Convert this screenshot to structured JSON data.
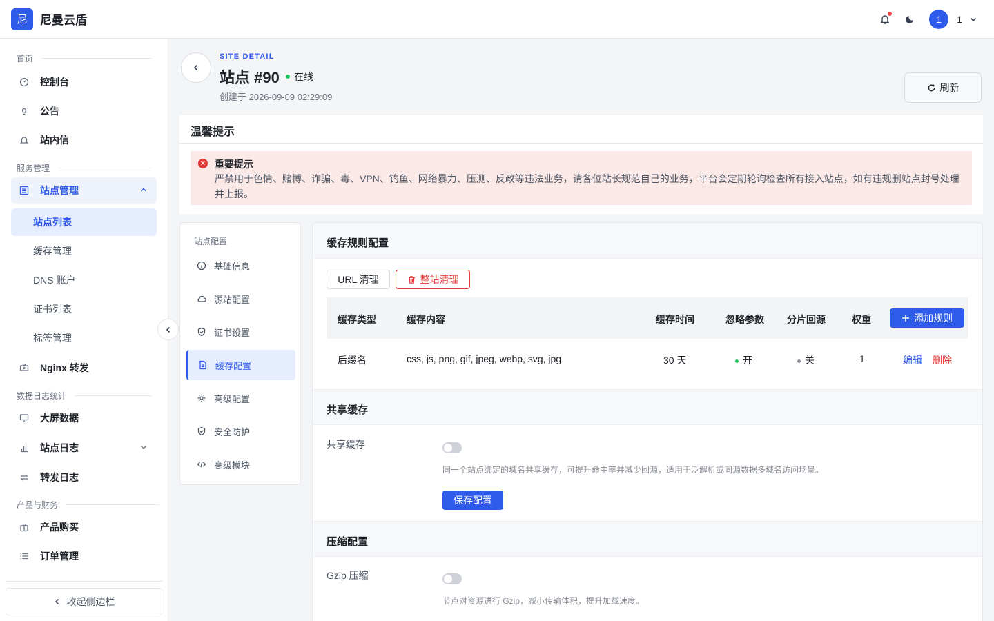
{
  "header": {
    "logo_char": "尼",
    "brand": "尼曼云盾",
    "avatar_char": "1",
    "user_name": "1"
  },
  "sidebar": {
    "groups": {
      "home": "首页",
      "service": "服务管理",
      "stats": "数据日志统计",
      "product": "产品与财务"
    },
    "items": {
      "dashboard": "控制台",
      "notice": "公告",
      "inbox": "站内信",
      "site_mgmt": "站点管理",
      "site_list": "站点列表",
      "cache_mgmt": "缓存管理",
      "dns": "DNS 账户",
      "cert_list": "证书列表",
      "tag_mgmt": "标签管理",
      "nginx": "Nginx 转发",
      "bigscreen": "大屏数据",
      "site_log": "站点日志",
      "forward_log": "转发日志",
      "buy": "产品购买",
      "orders": "订单管理"
    },
    "collapse_label": "收起侧边栏"
  },
  "page": {
    "eyebrow": "SITE DETAIL",
    "title": "站点 #90",
    "status": "在线",
    "created": "创建于 2026-09-09 02:29:09",
    "refresh": "刷新"
  },
  "tip": {
    "title": "温馨提示",
    "alert_title": "重要提示",
    "alert_body": "严禁用于色情、赌博、诈骗、毒、VPN、钓鱼、网络暴力、压测、反政等违法业务，请各位站长规范自己的业务，平台会定期轮询检查所有接入站点，如有违规删站点封号处理并上报。"
  },
  "config_menu": {
    "label": "站点配置",
    "items": [
      "基础信息",
      "源站配置",
      "证书设置",
      "缓存配置",
      "高级配置",
      "安全防护",
      "高级模块"
    ]
  },
  "cache_rules": {
    "title": "缓存规则配置",
    "url_purge": "URL 清理",
    "full_purge": "整站清理",
    "columns": [
      "缓存类型",
      "缓存内容",
      "缓存时间",
      "忽略参数",
      "分片回源",
      "权重"
    ],
    "add_rule": "添加规则",
    "rows": [
      {
        "type": "后缀名",
        "content": "css, js, png, gif, jpeg, webp, svg, jpg",
        "ttl": "30 天",
        "ignore_params": "开",
        "range_origin": "关",
        "weight": "1",
        "edit": "编辑",
        "delete": "删除"
      }
    ]
  },
  "shared_cache": {
    "title": "共享缓存",
    "label": "共享缓存",
    "enabled": false,
    "help": "同一个站点绑定的域名共享缓存，可提升命中率并减少回源，适用于泛解析或同源数据多域名访问场景。",
    "save": "保存配置"
  },
  "compression": {
    "title": "压缩配置",
    "label": "Gzip 压缩",
    "enabled": false,
    "help": "节点对资源进行 Gzip，减小传输体积，提升加载速度。"
  },
  "colors": {
    "primary": "#2f5bea",
    "danger": "#e53935",
    "online": "#22c55e",
    "alert_bg": "#fbe9e7"
  }
}
